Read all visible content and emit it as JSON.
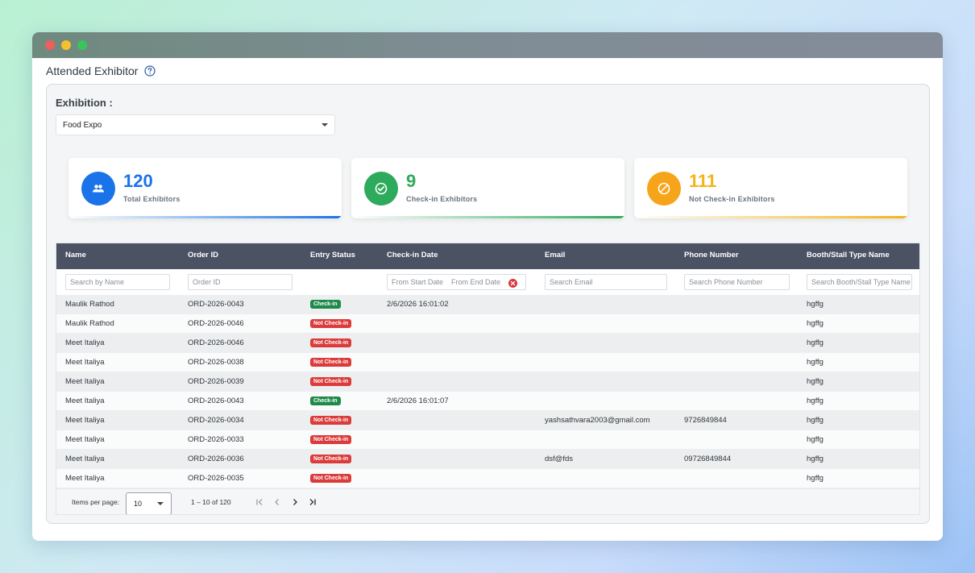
{
  "window": {
    "title_dots": [
      "close",
      "minimize",
      "maximize"
    ]
  },
  "page": {
    "title": "Attended Exhibitor",
    "help_icon": "question-circle-icon"
  },
  "filter": {
    "label": "Exhibition :",
    "selected": "Food Expo"
  },
  "stats": [
    {
      "value": "120",
      "label": "Total Exhibitors",
      "icon": "people-icon",
      "color": "#1a73e8"
    },
    {
      "value": "9",
      "label": "Check-in Exhibitors",
      "icon": "check-circle-icon",
      "color": "#2eaa5c"
    },
    {
      "value": "111",
      "label": "Not Check-in Exhibitors",
      "icon": "block-icon",
      "color": "#f4b41a"
    }
  ],
  "table": {
    "columns": [
      "Name",
      "Order ID",
      "Entry Status",
      "Check-in Date",
      "Email",
      "Phone Number",
      "Booth/Stall Type Name"
    ],
    "filters": {
      "name": "Search by Name",
      "order": "Order ID",
      "start_date": "From Start Date",
      "end_date": "From End Date",
      "email": "Search Email",
      "phone": "Search Phone Number",
      "booth": "Search Booth/Stall Type Name"
    },
    "rows": [
      {
        "name": "Maulik Rathod",
        "order": "ORD-2026-0043",
        "status": "Check-in",
        "date": "2/6/2026 16:01:02",
        "email": "",
        "phone": "",
        "booth": "hgffg"
      },
      {
        "name": "Maulik Rathod",
        "order": "ORD-2026-0046",
        "status": "Not Check-in",
        "date": "",
        "email": "",
        "phone": "",
        "booth": "hgffg"
      },
      {
        "name": "Meet Italiya",
        "order": "ORD-2026-0046",
        "status": "Not Check-in",
        "date": "",
        "email": "",
        "phone": "",
        "booth": "hgffg"
      },
      {
        "name": "Meet Italiya",
        "order": "ORD-2026-0038",
        "status": "Not Check-in",
        "date": "",
        "email": "",
        "phone": "",
        "booth": "hgffg"
      },
      {
        "name": "Meet Italiya",
        "order": "ORD-2026-0039",
        "status": "Not Check-in",
        "date": "",
        "email": "",
        "phone": "",
        "booth": "hgffg"
      },
      {
        "name": "Meet Italiya",
        "order": "ORD-2026-0043",
        "status": "Check-in",
        "date": "2/6/2026 16:01:07",
        "email": "",
        "phone": "",
        "booth": "hgffg"
      },
      {
        "name": "Meet Italiya",
        "order": "ORD-2026-0034",
        "status": "Not Check-in",
        "date": "",
        "email": "yashsathvara2003@gmail.com",
        "phone": "9726849844",
        "booth": "hgffg"
      },
      {
        "name": "Meet Italiya",
        "order": "ORD-2026-0033",
        "status": "Not Check-in",
        "date": "",
        "email": "",
        "phone": "",
        "booth": "hgffg"
      },
      {
        "name": "Meet Italiya",
        "order": "ORD-2026-0036",
        "status": "Not Check-in",
        "date": "",
        "email": "dsf@fds",
        "phone": "09726849844",
        "booth": "hgffg"
      },
      {
        "name": "Meet Italiya",
        "order": "ORD-2026-0035",
        "status": "Not Check-in",
        "date": "",
        "email": "",
        "phone": "",
        "booth": "hgffg"
      }
    ]
  },
  "paginator": {
    "items_label": "Items per page:",
    "page_size": "10",
    "range": "1 – 10 of 120"
  }
}
